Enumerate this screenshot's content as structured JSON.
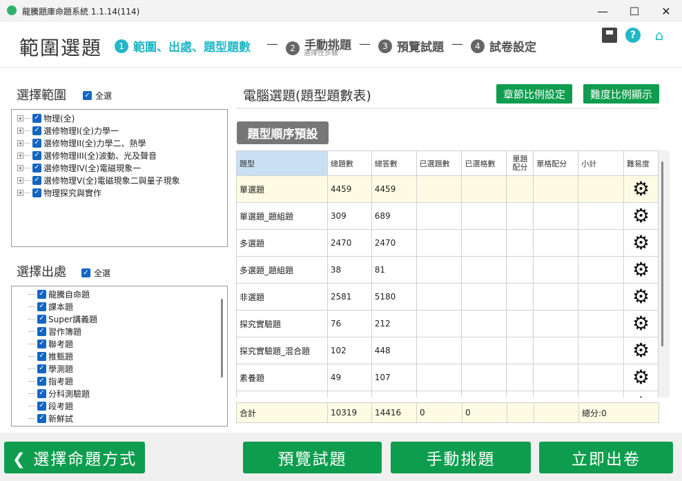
{
  "window": {
    "title": "龍騰題庫命題系統 1.1.14(114)",
    "min": "—",
    "max": "☐",
    "close": "✕"
  },
  "header": {
    "page_title": "範圍選題",
    "steps": [
      {
        "num": "1",
        "label": "範圍、出處、題型題數"
      },
      {
        "num": "2",
        "label": "手動挑題",
        "sub": "選擇性步驟"
      },
      {
        "num": "3",
        "label": "預覽試題"
      },
      {
        "num": "4",
        "label": "試卷設定"
      }
    ],
    "dash": "—",
    "icons": [
      "save-icon",
      "help-icon",
      "home-icon"
    ],
    "help_glyph": "?",
    "home_glyph": "⌂"
  },
  "scope": {
    "label": "選擇範圍",
    "select_all": "全選",
    "items": [
      "物理(全)",
      "選修物理I(全)力學一",
      "選修物理II(全)力學二、熱學",
      "選修物理III(全)波動、光及聲音",
      "選修物理IV(全)電磁現象一",
      "選修物理V(全)電磁現象二與量子現象",
      "物理探究與實作"
    ]
  },
  "source": {
    "label": "選擇出處",
    "select_all": "全選",
    "items": [
      "龍騰自命題",
      "課本題",
      "Super講義題",
      "習作簿題",
      "聯考題",
      "推甄題",
      "學測題",
      "指考題",
      "分科測驗題",
      "段考題",
      "新鮮試"
    ]
  },
  "main": {
    "title": "電腦選題(題型題數表)",
    "chapter_ratio_btn": "章節比例設定",
    "difficulty_ratio_btn": "難度比例顯示",
    "preset_btn": "題型順序預設",
    "columns": [
      "題型",
      "總題數",
      "總答數",
      "已選題數",
      "已選格數",
      "單題配分",
      "單格配分",
      "小計",
      "難易度"
    ],
    "rows": [
      {
        "type": "單選題",
        "total_q": "4459",
        "total_a": "4459"
      },
      {
        "type": "單選題_題組題",
        "total_q": "309",
        "total_a": "689"
      },
      {
        "type": "多選題",
        "total_q": "2470",
        "total_a": "2470"
      },
      {
        "type": "多選題_題組題",
        "total_q": "38",
        "total_a": "81"
      },
      {
        "type": "非選題",
        "total_q": "2581",
        "total_a": "5180"
      },
      {
        "type": "探究實驗題",
        "total_q": "76",
        "total_a": "212"
      },
      {
        "type": "探究實驗題_混合題",
        "total_q": "102",
        "total_a": "448"
      },
      {
        "type": "素養題",
        "total_q": "49",
        "total_a": "107"
      }
    ],
    "totals": {
      "label": "合計",
      "total_q": "10319",
      "total_a": "14416",
      "selected_q": "0",
      "selected_cells": "0",
      "score": "總分:0"
    }
  },
  "footer": {
    "back_btn": "❮ 選擇命題方式",
    "preview_btn": "預覽試題",
    "manual_btn": "手動挑題",
    "generate_btn": "立即出卷"
  }
}
